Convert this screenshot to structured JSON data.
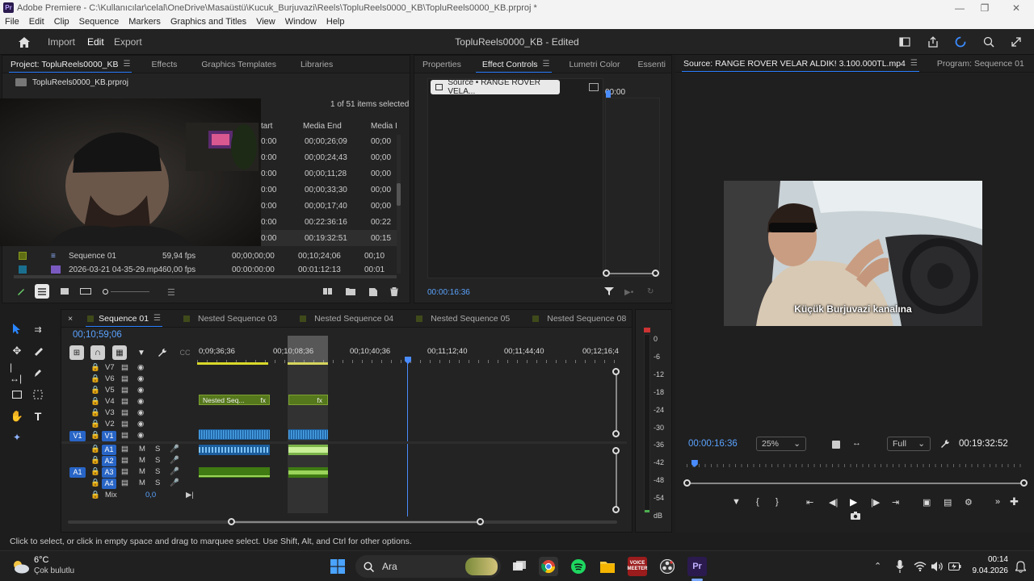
{
  "titlebar": {
    "title": "Adobe Premiere - C:\\Kullanıcılar\\celal\\OneDrive\\Masaüstü\\Kucuk_Burjuvazi\\Reels\\TopluReels0000_KB\\TopluReels0000_KB.prproj *",
    "app_icon": "Pr"
  },
  "menu": [
    "File",
    "Edit",
    "Clip",
    "Sequence",
    "Markers",
    "Graphics and Titles",
    "View",
    "Window",
    "Help"
  ],
  "header": {
    "home_icon": "home-icon",
    "workspaces": [
      "Import",
      "Edit",
      "Export"
    ],
    "active_workspace": "Edit",
    "project_title": "TopluReels0000_KB - Edited"
  },
  "project": {
    "tabs": [
      "Project: TopluReels0000_KB",
      "Effects",
      "Graphics Templates",
      "Libraries"
    ],
    "file": "TopluReels0000_KB.prproj",
    "items_selected": "1 of 51 items selected",
    "columns": [
      "tart",
      "Media End",
      "Media I"
    ],
    "rows": [
      [
        "0:00",
        "00;00;26;09",
        "00;00"
      ],
      [
        "0:00",
        "00;00;24;43",
        "00;00"
      ],
      [
        "0:00",
        "00;00;11;28",
        "00;00"
      ],
      [
        "0:00",
        "00;00;33;30",
        "00;00"
      ],
      [
        "0:00",
        "00;00;17;40",
        "00;00"
      ],
      [
        "0:00",
        "00:22:36:16",
        "00:22"
      ],
      [
        "0:00",
        "00:19:32:51",
        "00:15"
      ]
    ],
    "seq_row": {
      "name": "Sequence 01",
      "fps": "59,94 fps",
      "start": "00;00;00;00",
      "end": "00;10;24;06",
      "inpt": "00;10"
    },
    "clip_row": {
      "name": "2026-03-21 04-35-29.mp4",
      "fps": "60,00 fps",
      "start": "00:00:00:00",
      "end": "00:01:12:13",
      "inpt": "00:01"
    }
  },
  "effects": {
    "tabs": [
      "Properties",
      "Effect Controls",
      "Lumetri Color",
      "Essenti"
    ],
    "source_clip": "Source • RANGE ROVER VELA...",
    "ruler_time": "00:00",
    "timecode": "00:00:16:36"
  },
  "source": {
    "tabs": [
      "Source: RANGE ROVER VELAR ALDIK! 3.100.000TL.mp4",
      "Program: Sequence 01"
    ],
    "caption": "Küçük Burjuvazi kanalına",
    "timecode": "00:00:16:36",
    "zoom": "25%",
    "quality": "Full",
    "duration": "00:19:32:52",
    "playhead_pct": 0.014
  },
  "timeline": {
    "tabs": [
      "Sequence 01",
      "Nested Sequence 03",
      "Nested Sequence 04",
      "Nested Sequence 05",
      "Nested Sequence 08"
    ],
    "timecode": "00;10;59;06",
    "ruler": [
      "0;09;36;36",
      "00;10;08;36",
      "00;10;40;36",
      "00;11;12;40",
      "00;11;44;40",
      "00;12;16;4"
    ],
    "video_tracks": [
      "V7",
      "V6",
      "V5",
      "V4",
      "V3",
      "V2",
      "V1"
    ],
    "audio_tracks": [
      "A1",
      "A2",
      "A3",
      "A4"
    ],
    "mix_label": "Mix",
    "mix_value": "0,0",
    "nested_clip": "Nested Seq...",
    "fx": "fx",
    "src_v": "V1",
    "src_a": "A1",
    "m": "M",
    "s": "S"
  },
  "meter": {
    "scale": [
      "0",
      "-6",
      "-12",
      "-18",
      "-24",
      "-30",
      "-36",
      "-42",
      "-48",
      "-54",
      "dB"
    ]
  },
  "status": "Click to select, or click in empty space and drag to marquee select. Use Shift, Alt, and Ctrl for other options.",
  "taskbar": {
    "weather_temp": "6°C",
    "weather_desc": "Çok bulutlu",
    "search": "Ara",
    "time": "00:14",
    "date": "9.04.2026",
    "voice_label": "VOICE MEETER"
  },
  "colors": {
    "accent": "#2a7fff",
    "clip_green": "#4a7a1a",
    "audio_green": "#9acb5a",
    "video_blue": "#1f6fb8",
    "timecode_blue": "#5aa3ff"
  }
}
